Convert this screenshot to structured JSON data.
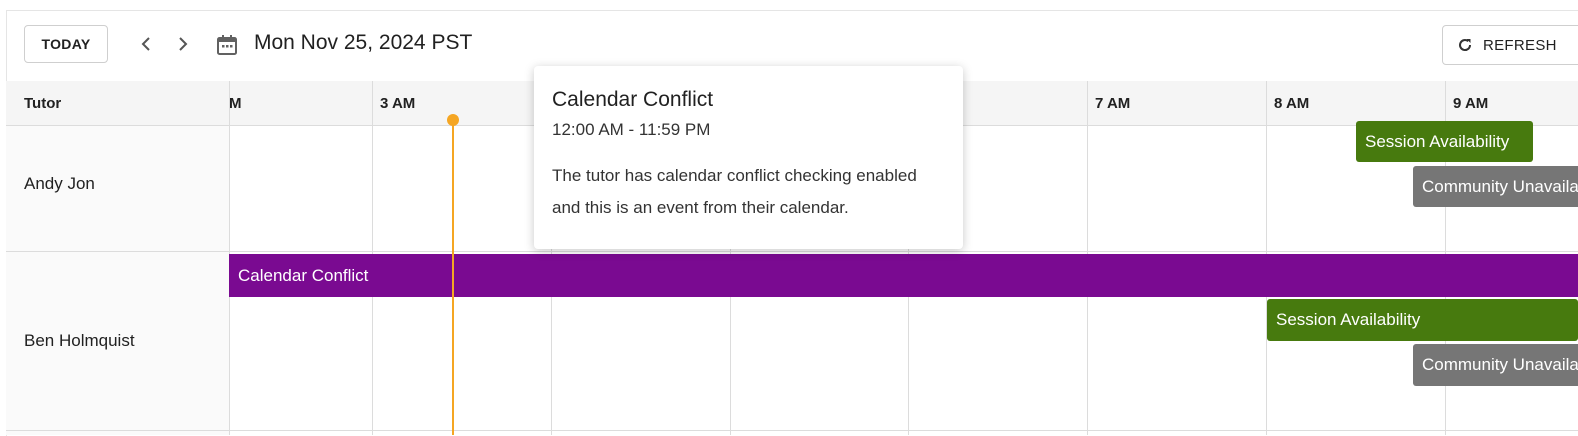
{
  "toolbar": {
    "today_label": "TODAY",
    "date_title": "Mon Nov 25, 2024 PST",
    "refresh_label": "REFRESH"
  },
  "grid": {
    "tutor_header": "Tutor",
    "time_labels": [
      "M",
      "3 AM",
      "7 AM",
      "8 AM",
      "9 AM"
    ]
  },
  "tutors": [
    {
      "name": "Andy Jon"
    },
    {
      "name": "Ben Holmquist"
    }
  ],
  "events": {
    "andy_session": "Session Availability",
    "andy_community": "Community Unavailability",
    "ben_conflict": "Calendar Conflict",
    "ben_session": "Session Availability",
    "ben_community": "Community Unavailability"
  },
  "tooltip": {
    "title": "Calendar Conflict",
    "time_range": "12:00 AM - 11:59 PM",
    "body": "The tutor has calendar conflict checking enabled and this is an event from their calendar."
  },
  "colors": {
    "conflict": "#7a0a91",
    "session": "#477a0e",
    "community": "#767676",
    "now_indicator": "#f5a623"
  }
}
